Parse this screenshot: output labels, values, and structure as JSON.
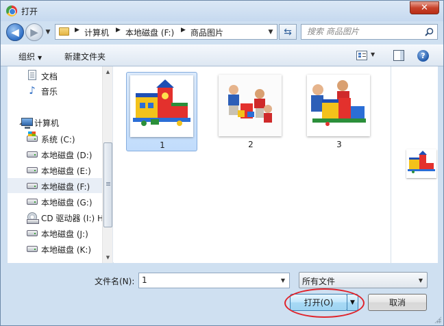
{
  "window": {
    "title": "打开",
    "close_label": "✕"
  },
  "address_bar": {
    "breadcrumbs": [
      "计算机",
      "本地磁盘 (F:)",
      "商品图片"
    ],
    "search_placeholder": "搜索 商品图片"
  },
  "toolbar": {
    "organize_label": "组织",
    "new_folder_label": "新建文件夹",
    "help_label": "?"
  },
  "sidebar": {
    "items": [
      {
        "label": "文档",
        "icon": "document-icon"
      },
      {
        "label": "音乐",
        "icon": "music-icon"
      },
      {
        "label": "计算机",
        "icon": "computer-icon"
      },
      {
        "label": "系统 (C:)",
        "icon": "system-drive-icon"
      },
      {
        "label": "本地磁盘 (D:)",
        "icon": "drive-icon"
      },
      {
        "label": "本地磁盘 (E:)",
        "icon": "drive-icon"
      },
      {
        "label": "本地磁盘 (F:)",
        "icon": "drive-icon",
        "selected": true
      },
      {
        "label": "本地磁盘 (G:)",
        "icon": "drive-icon"
      },
      {
        "label": "CD 驱动器 (I:) H",
        "icon": "cd-drive-icon"
      },
      {
        "label": "本地磁盘 (J:)",
        "icon": "drive-icon"
      },
      {
        "label": "本地磁盘 (K:)",
        "icon": "drive-icon"
      }
    ]
  },
  "files": [
    {
      "name": "1",
      "selected": true
    },
    {
      "name": "2",
      "selected": false
    },
    {
      "name": "3",
      "selected": false
    }
  ],
  "footer": {
    "filename_label": "文件名(N):",
    "filename_value": "1",
    "filetype_value": "所有文件",
    "open_label": "打开(O)",
    "cancel_label": "取消"
  },
  "colors": {
    "accent_highlight": "#e0232b",
    "selection": "#c1dcfc",
    "frame": "#cfe0f1"
  }
}
